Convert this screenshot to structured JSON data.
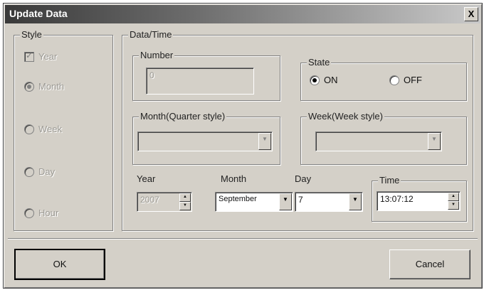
{
  "window": {
    "title": "Update Data",
    "close_glyph": "X"
  },
  "style_group": {
    "legend": "Style",
    "options": [
      {
        "label": "Year",
        "kind": "check",
        "checked": true
      },
      {
        "label": "Month",
        "kind": "radio",
        "checked": true
      },
      {
        "label": "Week",
        "kind": "radio",
        "checked": false
      },
      {
        "label": "Day",
        "kind": "radio",
        "checked": false
      },
      {
        "label": "Hour",
        "kind": "radio",
        "checked": false
      }
    ]
  },
  "datetime_group": {
    "legend": "Data/Time",
    "number": {
      "legend": "Number",
      "value": "0"
    },
    "state": {
      "legend": "State",
      "on_label": "ON",
      "off_label": "OFF",
      "selected": "ON"
    },
    "month_quarter": {
      "legend": "Month(Quarter style)",
      "value": ""
    },
    "week_style": {
      "legend": "Week(Week style)",
      "value": ""
    },
    "year": {
      "label": "Year",
      "value": "2007"
    },
    "month": {
      "label": "Month",
      "value": "September"
    },
    "day": {
      "label": "Day",
      "value": "7"
    },
    "time": {
      "label": "Time",
      "value": "13:07:12"
    }
  },
  "buttons": {
    "ok": "OK",
    "cancel": "Cancel"
  },
  "icons": {
    "dropdown": "chevron-down-icon",
    "spin_up": "arrow-up-icon",
    "spin_down": "arrow-down-icon",
    "close": "close-icon"
  }
}
